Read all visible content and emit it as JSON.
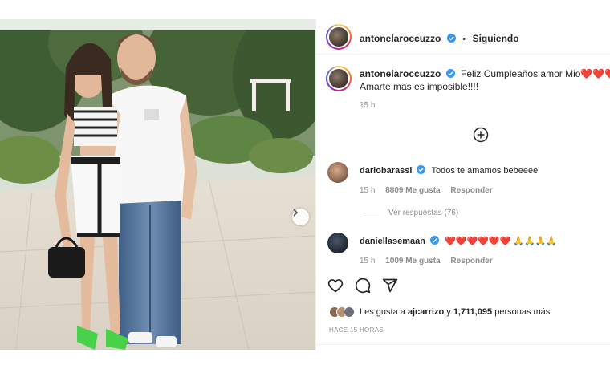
{
  "post": {
    "author": "antonelaroccuzzo",
    "follow_state": "Siguiendo",
    "caption_line1": "Feliz Cumpleaños amor Mio❤️❤️❤️❤️",
    "caption_line2": "Amarte mas es imposible!!!!",
    "caption_time": "15 h"
  },
  "comments": [
    {
      "user": "dariobarassi",
      "text": "Todos te amamos bebeeee",
      "time": "15 h",
      "likes": "8809 Me gusta",
      "reply": "Responder"
    },
    {
      "user": "daniellasemaan",
      "text": "❤️❤️❤️❤️❤️❤️ 🙏🙏🙏🙏",
      "time": "15 h",
      "likes": "1009 Me gusta",
      "reply": "Responder"
    }
  ],
  "replies_link": "Ver respuestas (76)",
  "likes_summary": {
    "prefix": "Les gusta a ",
    "user": "ajcarrizo",
    "middle": " y ",
    "count": "1,711,095",
    "suffix": " personas más"
  },
  "time_ago": "HACE 15 HORAS",
  "icons": [
    "heart-icon",
    "comment-icon",
    "share-icon",
    "plus-circle-icon",
    "verified-badge-icon",
    "chevron-right-icon"
  ],
  "colors": {
    "verified": "#3897f0",
    "muted": "#8e8e8e",
    "text": "#262626"
  }
}
